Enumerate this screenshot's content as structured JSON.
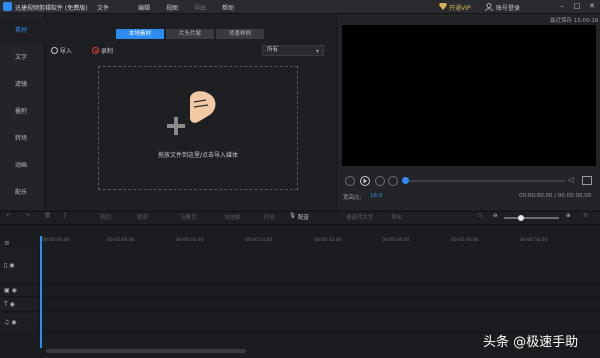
{
  "titlebar": {
    "app_title": "迅捷视频剪辑软件 (免费版)",
    "menu": [
      "文件",
      "编辑",
      "视图",
      "导出",
      "帮助"
    ],
    "vip_label": "开通VIP",
    "account_label": "账号登录"
  },
  "sidebar": {
    "items": [
      {
        "label": "素材",
        "active": true
      },
      {
        "label": "文字",
        "active": false
      },
      {
        "label": "滤镜",
        "active": false
      },
      {
        "label": "叠附",
        "active": false
      },
      {
        "label": "转场",
        "active": false
      },
      {
        "label": "动画",
        "active": false
      },
      {
        "label": "配乐",
        "active": false
      }
    ]
  },
  "media": {
    "tabs": [
      {
        "label": "本地素材",
        "active": true
      },
      {
        "label": "片头片尾",
        "active": false
      },
      {
        "label": "背景样例",
        "active": false
      }
    ],
    "import_label": "导入",
    "record_label": "录制",
    "filter_value": "所有",
    "drop_text": "拖放文件到这里/点击导入媒体"
  },
  "preview": {
    "save_status": "最近保存 15:00:16",
    "aspect_label": "宽高比:",
    "aspect_value": "16:9",
    "time": "00:00:00.00 / 00:00:00.00",
    "progress": 0
  },
  "toolbar": {
    "items": [
      {
        "label": "剪切",
        "enabled": false
      },
      {
        "label": "裁剪",
        "enabled": false
      },
      {
        "label": "马赛克",
        "enabled": false
      },
      {
        "label": "冻结帧",
        "enabled": false
      },
      {
        "label": "时长",
        "enabled": false
      },
      {
        "label": "配音",
        "enabled": true
      },
      {
        "label": "语音转文字",
        "enabled": false
      },
      {
        "label": "导出",
        "enabled": false
      }
    ],
    "zoom_level": 0.3
  },
  "timeline": {
    "ticks": [
      "00:00:00.00",
      "00:00:08.00",
      "00:00:16.00",
      "00:00:24.00",
      "00:00:32.00",
      "00:00:40.00",
      "00:00:48.00",
      "00:00:56.00"
    ],
    "tracks": [
      "video",
      "picture",
      "text",
      "audio"
    ]
  },
  "watermark": "头条 @极速手助",
  "colors": {
    "accent": "#2d8cf0",
    "background": "#1b1c1f",
    "vip_gold": "#d8b35a"
  }
}
